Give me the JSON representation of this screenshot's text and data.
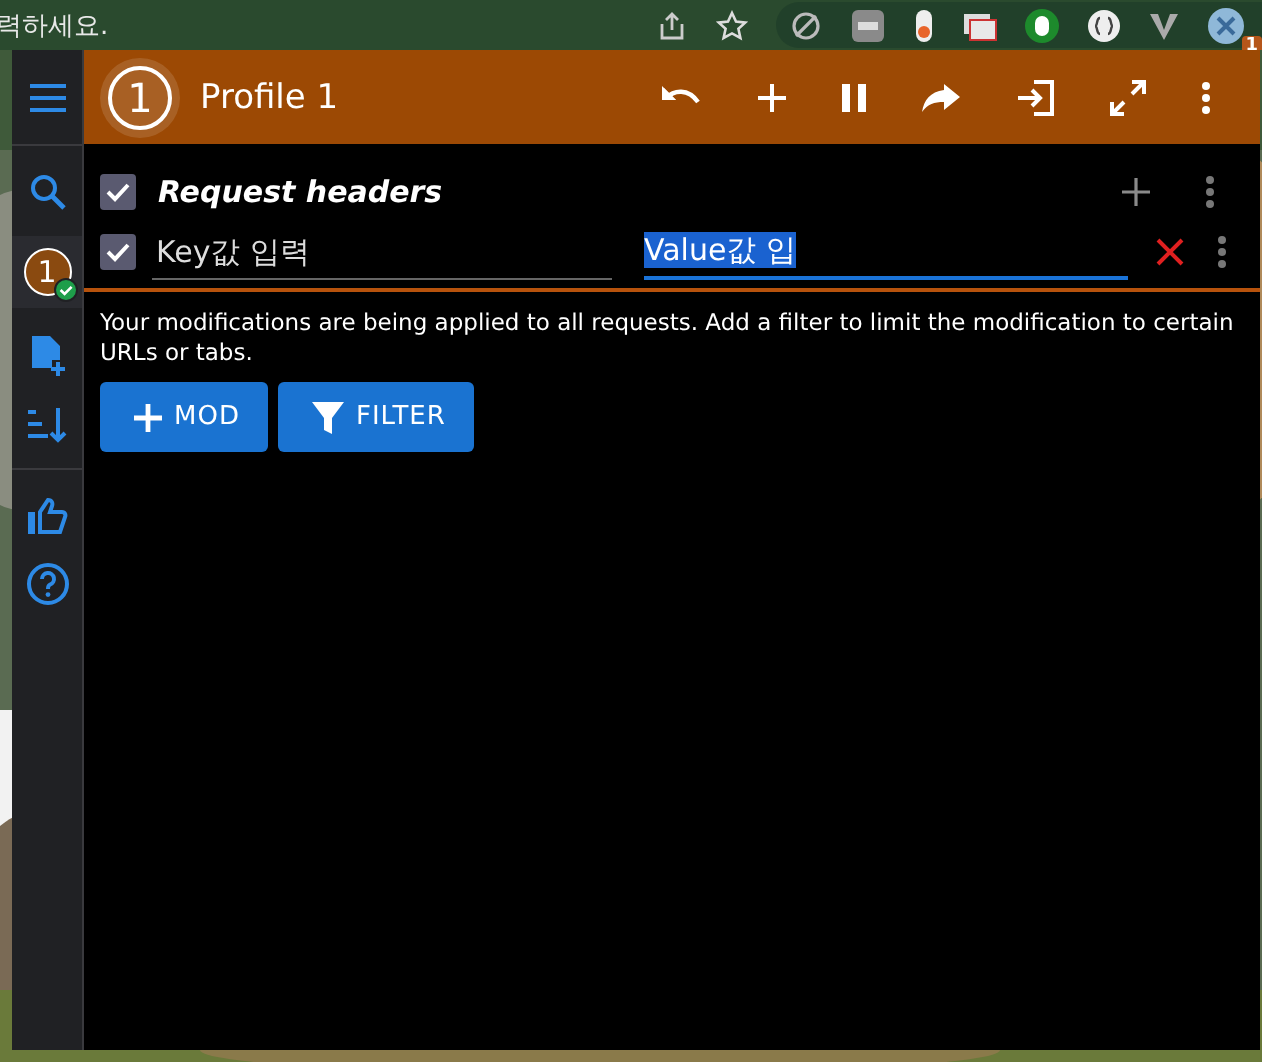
{
  "browser": {
    "address_text": "력하세요.",
    "extension_badge": "1"
  },
  "profile": {
    "number": "1",
    "name": "Profile 1",
    "badge": "1",
    "active": true
  },
  "header_group": {
    "title": "Request headers",
    "enabled": true
  },
  "headers": [
    {
      "enabled": true,
      "key": "Key값 입력",
      "value": "Value값 입",
      "value_selected": true
    }
  ],
  "notice": "Your modifications are being applied to all requests. Add a filter to limit the modification to certain URLs or tabs.",
  "buttons": [
    {
      "kind": "mod",
      "label": "MOD"
    },
    {
      "kind": "filter",
      "label": "FILTER"
    }
  ]
}
